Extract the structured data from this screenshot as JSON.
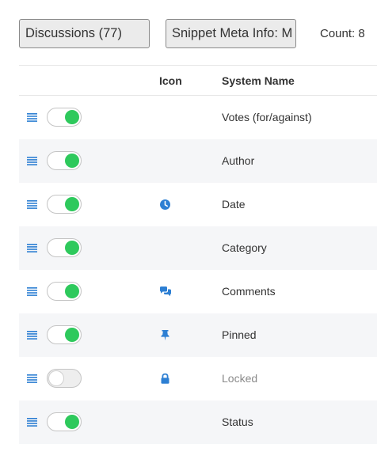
{
  "toolbar": {
    "discussions_select": "Discussions (77)",
    "snippet_select": "Snippet Meta Info: M",
    "count": "Count: 8"
  },
  "table": {
    "headers": {
      "icon": "Icon",
      "system_name": "System Name"
    },
    "rows": [
      {
        "enabled": true,
        "icon": "",
        "name": "Votes (for/against)"
      },
      {
        "enabled": true,
        "icon": "",
        "name": "Author"
      },
      {
        "enabled": true,
        "icon": "clock-icon",
        "name": "Date"
      },
      {
        "enabled": true,
        "icon": "",
        "name": "Category"
      },
      {
        "enabled": true,
        "icon": "comments-icon",
        "name": "Comments"
      },
      {
        "enabled": true,
        "icon": "pin-icon",
        "name": "Pinned"
      },
      {
        "enabled": false,
        "icon": "lock-icon",
        "name": "Locked"
      },
      {
        "enabled": true,
        "icon": "",
        "name": "Status"
      }
    ]
  },
  "colors": {
    "accent_blue": "#2d7fd3",
    "toggle_on": "#2ec95c",
    "row_alt": "#f5f6f8"
  }
}
